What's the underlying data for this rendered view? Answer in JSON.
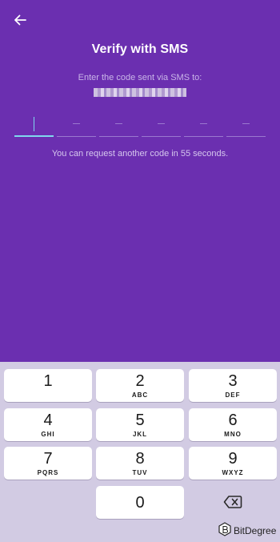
{
  "header": {
    "back_icon": "arrow-left-icon",
    "title": "Verify with SMS",
    "subtitle": "Enter the code sent via SMS to:",
    "phone_number_masked": ""
  },
  "code_input": {
    "length": 6,
    "active_index": 0,
    "values": [
      "",
      "",
      "",
      "",
      "",
      ""
    ]
  },
  "resend_message": "You can request another code in 55 seconds.",
  "keyboard": {
    "keys": [
      {
        "num": "1",
        "letters": ""
      },
      {
        "num": "2",
        "letters": "ABC"
      },
      {
        "num": "3",
        "letters": "DEF"
      },
      {
        "num": "4",
        "letters": "GHI"
      },
      {
        "num": "5",
        "letters": "JKL"
      },
      {
        "num": "6",
        "letters": "MNO"
      },
      {
        "num": "7",
        "letters": "PQRS"
      },
      {
        "num": "8",
        "letters": "TUV"
      },
      {
        "num": "9",
        "letters": "WXYZ"
      },
      {
        "num": "0",
        "letters": ""
      }
    ],
    "delete_icon": "backspace-icon"
  },
  "watermark": {
    "text": "BitDegree"
  },
  "colors": {
    "background": "#6b2fb0",
    "keyboard_background": "#d2cbe3",
    "accent": "#7fd8ee"
  }
}
